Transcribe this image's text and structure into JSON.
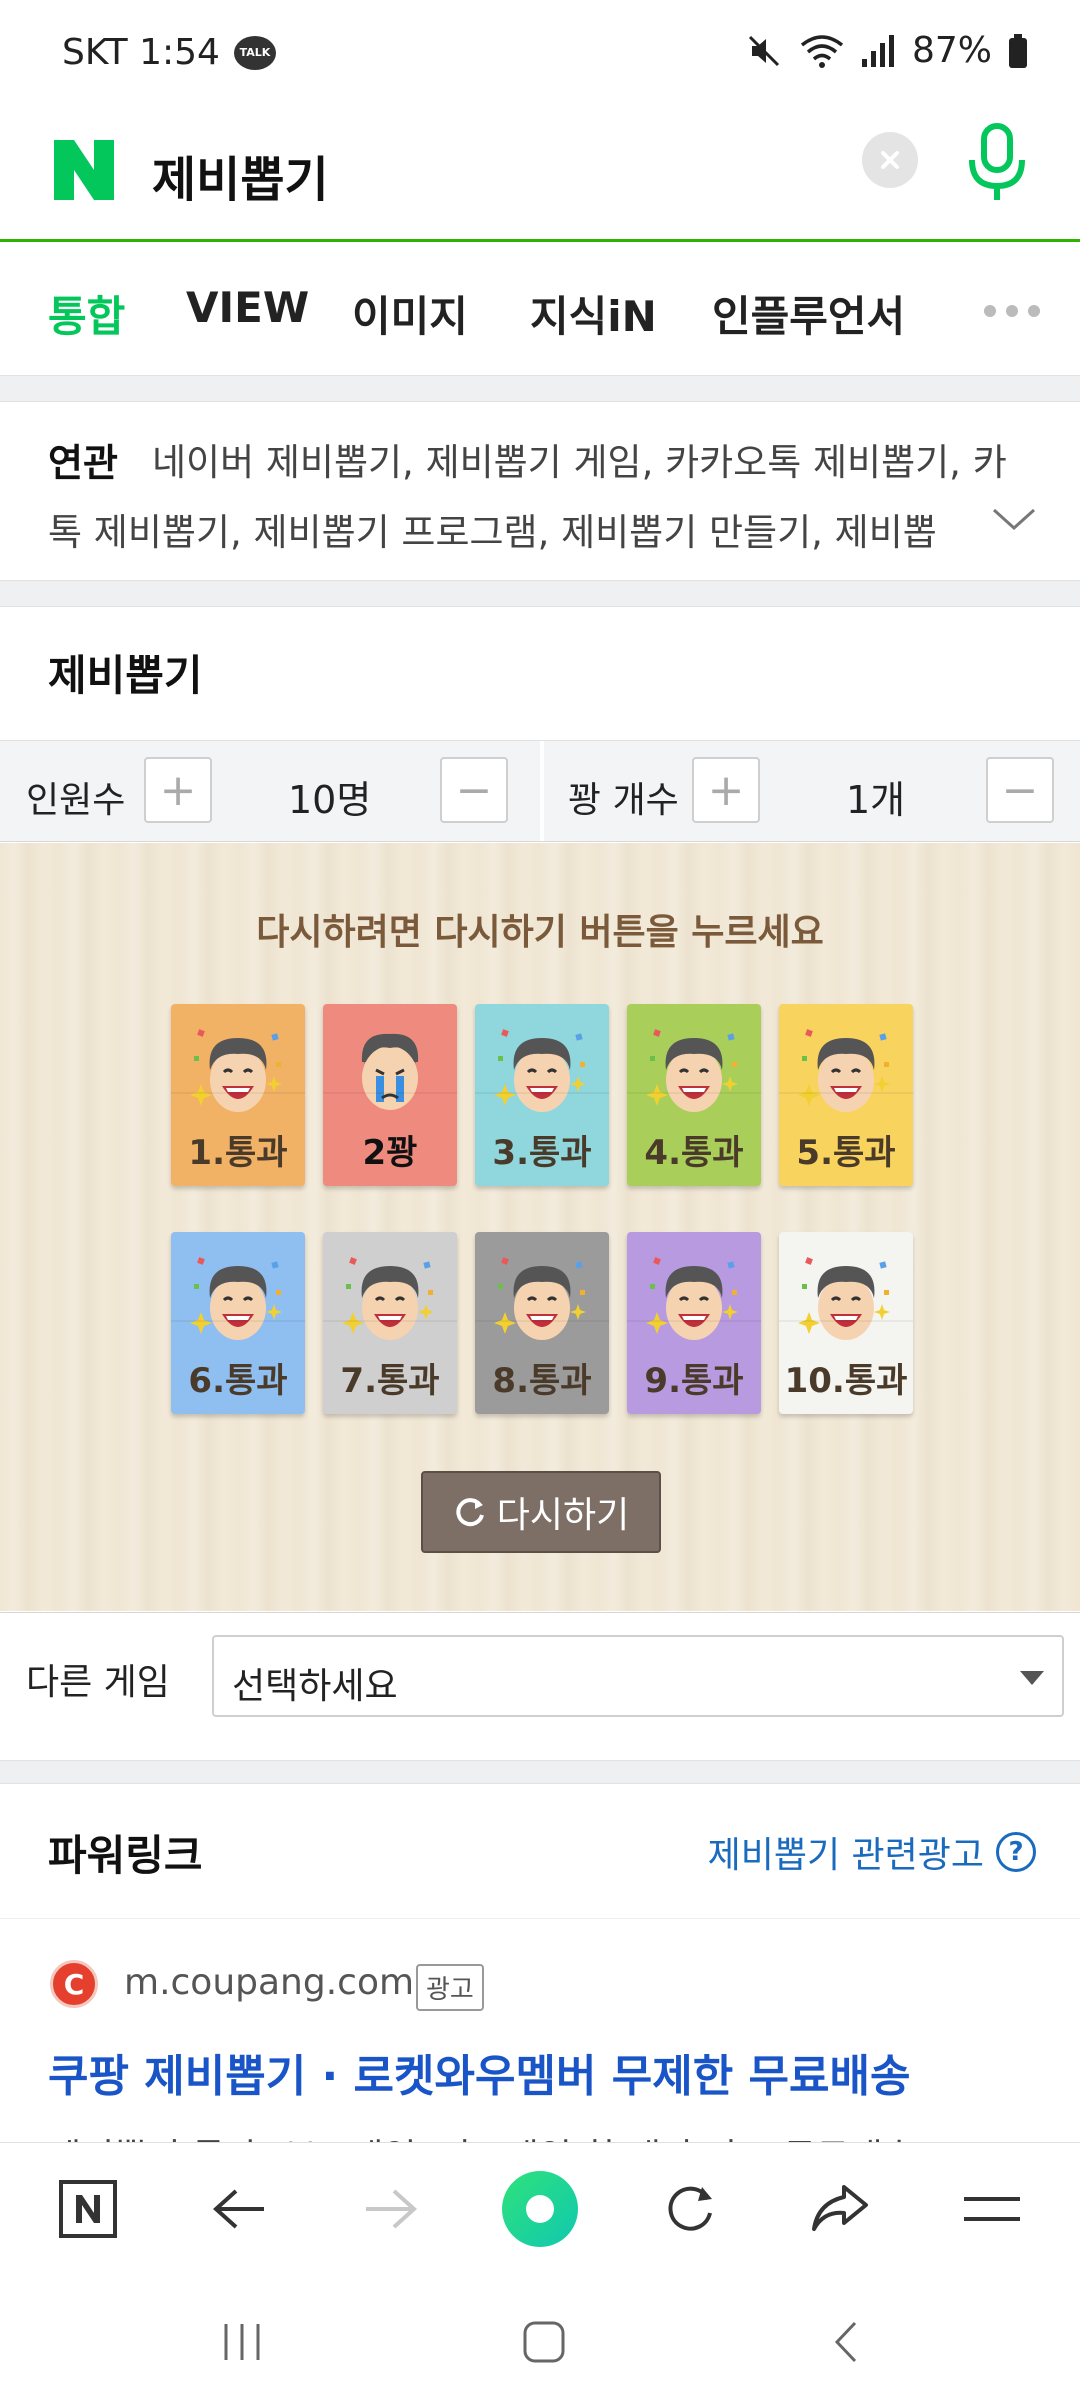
{
  "status": {
    "carrier_time": "SKT 1:54",
    "talk": "TALK",
    "battery": "87%"
  },
  "search": {
    "query": "제비뽑기"
  },
  "tabs": [
    "통합",
    "VIEW",
    "이미지",
    "지식iN",
    "인플루언서"
  ],
  "related": {
    "label": "연관",
    "text": "네이버 제비뽑기, 제비뽑기 게임, 카카오톡 제비뽑기, 카톡 제비뽑기, 제비뽑기 프로그램, 제비뽑기 만들기, 제비뽑"
  },
  "game": {
    "title": "제비뽑기",
    "people_label": "인원수",
    "people_value": "10명",
    "bomb_label": "꽝 개수",
    "bomb_value": "1개",
    "message": "다시하려면 다시하기 버튼을 누르세요",
    "cards": [
      {
        "label": "1.통과",
        "color": "#f2b266",
        "lose": false
      },
      {
        "label": "2꽝",
        "color": "#ef8a7f",
        "lose": true
      },
      {
        "label": "3.통과",
        "color": "#8fd6dd",
        "lose": false
      },
      {
        "label": "4.통과",
        "color": "#a9cf5a",
        "lose": false
      },
      {
        "label": "5.통과",
        "color": "#f8d35e",
        "lose": false
      },
      {
        "label": "6.통과",
        "color": "#8fbef0",
        "lose": false
      },
      {
        "label": "7.통과",
        "color": "#cfcfcf",
        "lose": false
      },
      {
        "label": "8.통과",
        "color": "#9b9b9b",
        "lose": false
      },
      {
        "label": "9.통과",
        "color": "#b89ae0",
        "lose": false
      },
      {
        "label": "10.통과",
        "color": "#f4f4f1",
        "lose": false
      }
    ],
    "retry_label": "다시하기"
  },
  "other_game": {
    "label": "다른 게임",
    "select_value": "선택하세요"
  },
  "powerlink": {
    "title": "파워링크",
    "related_ad": "제비뽑기 관련광고",
    "ad": {
      "domain": "m.coupang.com",
      "badge": "광고",
      "title": "쿠팡 제비뽑기 · 로켓와우멤버 무제한 무료배송",
      "desc": "제비뽑기 통과! 보드게임, 카드게임 한 개만 사도 무료배송"
    }
  },
  "colors": {
    "naver_green": "#03c75a",
    "link_blue": "#1a55c8"
  }
}
